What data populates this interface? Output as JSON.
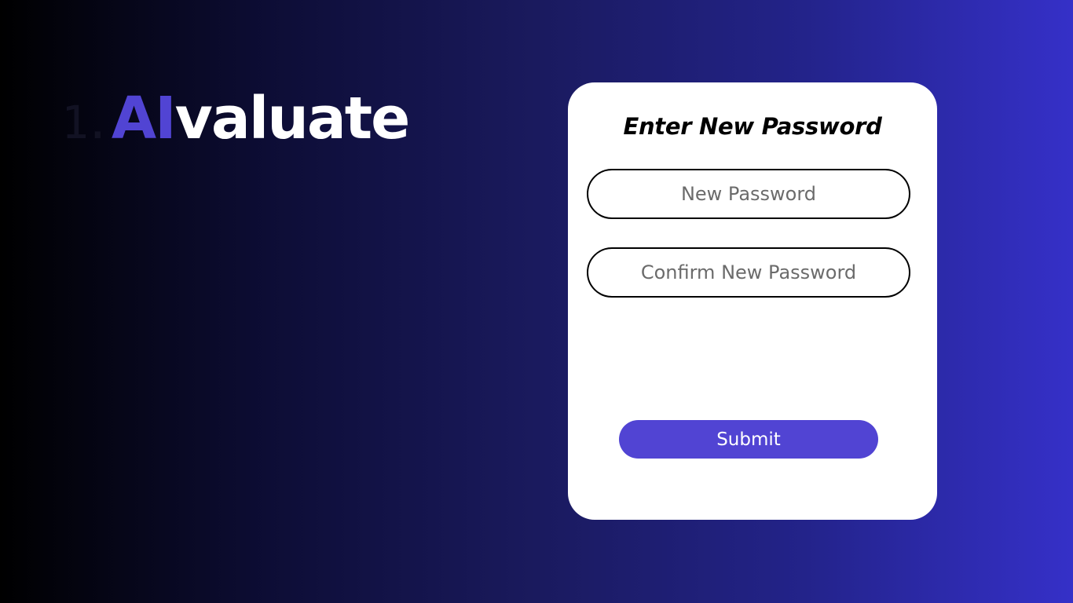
{
  "brand": {
    "number": "1.",
    "accent": "AI",
    "rest": "valuate"
  },
  "form": {
    "title": "Enter New Password",
    "new_password": {
      "placeholder": "New Password",
      "value": ""
    },
    "confirm_password": {
      "placeholder": "Confirm New Password",
      "value": ""
    },
    "submit_label": "Submit"
  },
  "colors": {
    "accent": "#5144d3",
    "gradient_start": "#000000",
    "gradient_end": "#3530c8",
    "card": "#ffffff"
  }
}
